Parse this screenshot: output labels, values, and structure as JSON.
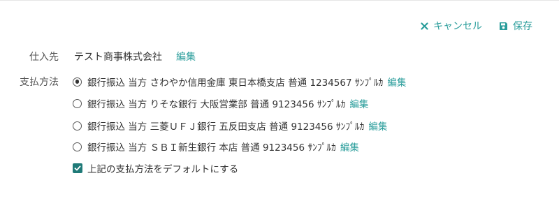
{
  "toolbar": {
    "cancel_label": "キャンセル",
    "save_label": "保存",
    "cancel_icon": "close-icon",
    "save_icon": "save-icon"
  },
  "supplier": {
    "label": "仕入先",
    "name": "テスト商事株式会社",
    "edit_label": "編集"
  },
  "payment": {
    "label": "支払方法",
    "options": [
      {
        "text": "銀行振込 当方 さわやか信用金庫 東日本橋支店 普通 1234567 ｻﾝﾌﾟﾙｶ",
        "edit_label": "編集",
        "selected": true
      },
      {
        "text": "銀行振込 当方 りそな銀行 大阪営業部 普通 9123456 ｻﾝﾌﾟﾙｶ",
        "edit_label": "編集",
        "selected": false
      },
      {
        "text": "銀行振込 当方 三菱ＵＦＪ銀行 五反田支店 普通 9123456 ｻﾝﾌﾟﾙｶ",
        "edit_label": "編集",
        "selected": false
      },
      {
        "text": "銀行振込 当方 ＳＢＩ新生銀行 本店 普通 9123456 ｻﾝﾌﾟﾙｶ",
        "edit_label": "編集",
        "selected": false
      }
    ],
    "default_checkbox_label": "上記の支払方法をデフォルトにする",
    "default_checked": true
  },
  "colors": {
    "accent": "#2a9d9b",
    "checkbox": "#1f7a78",
    "text": "#333333",
    "label": "#555555"
  }
}
